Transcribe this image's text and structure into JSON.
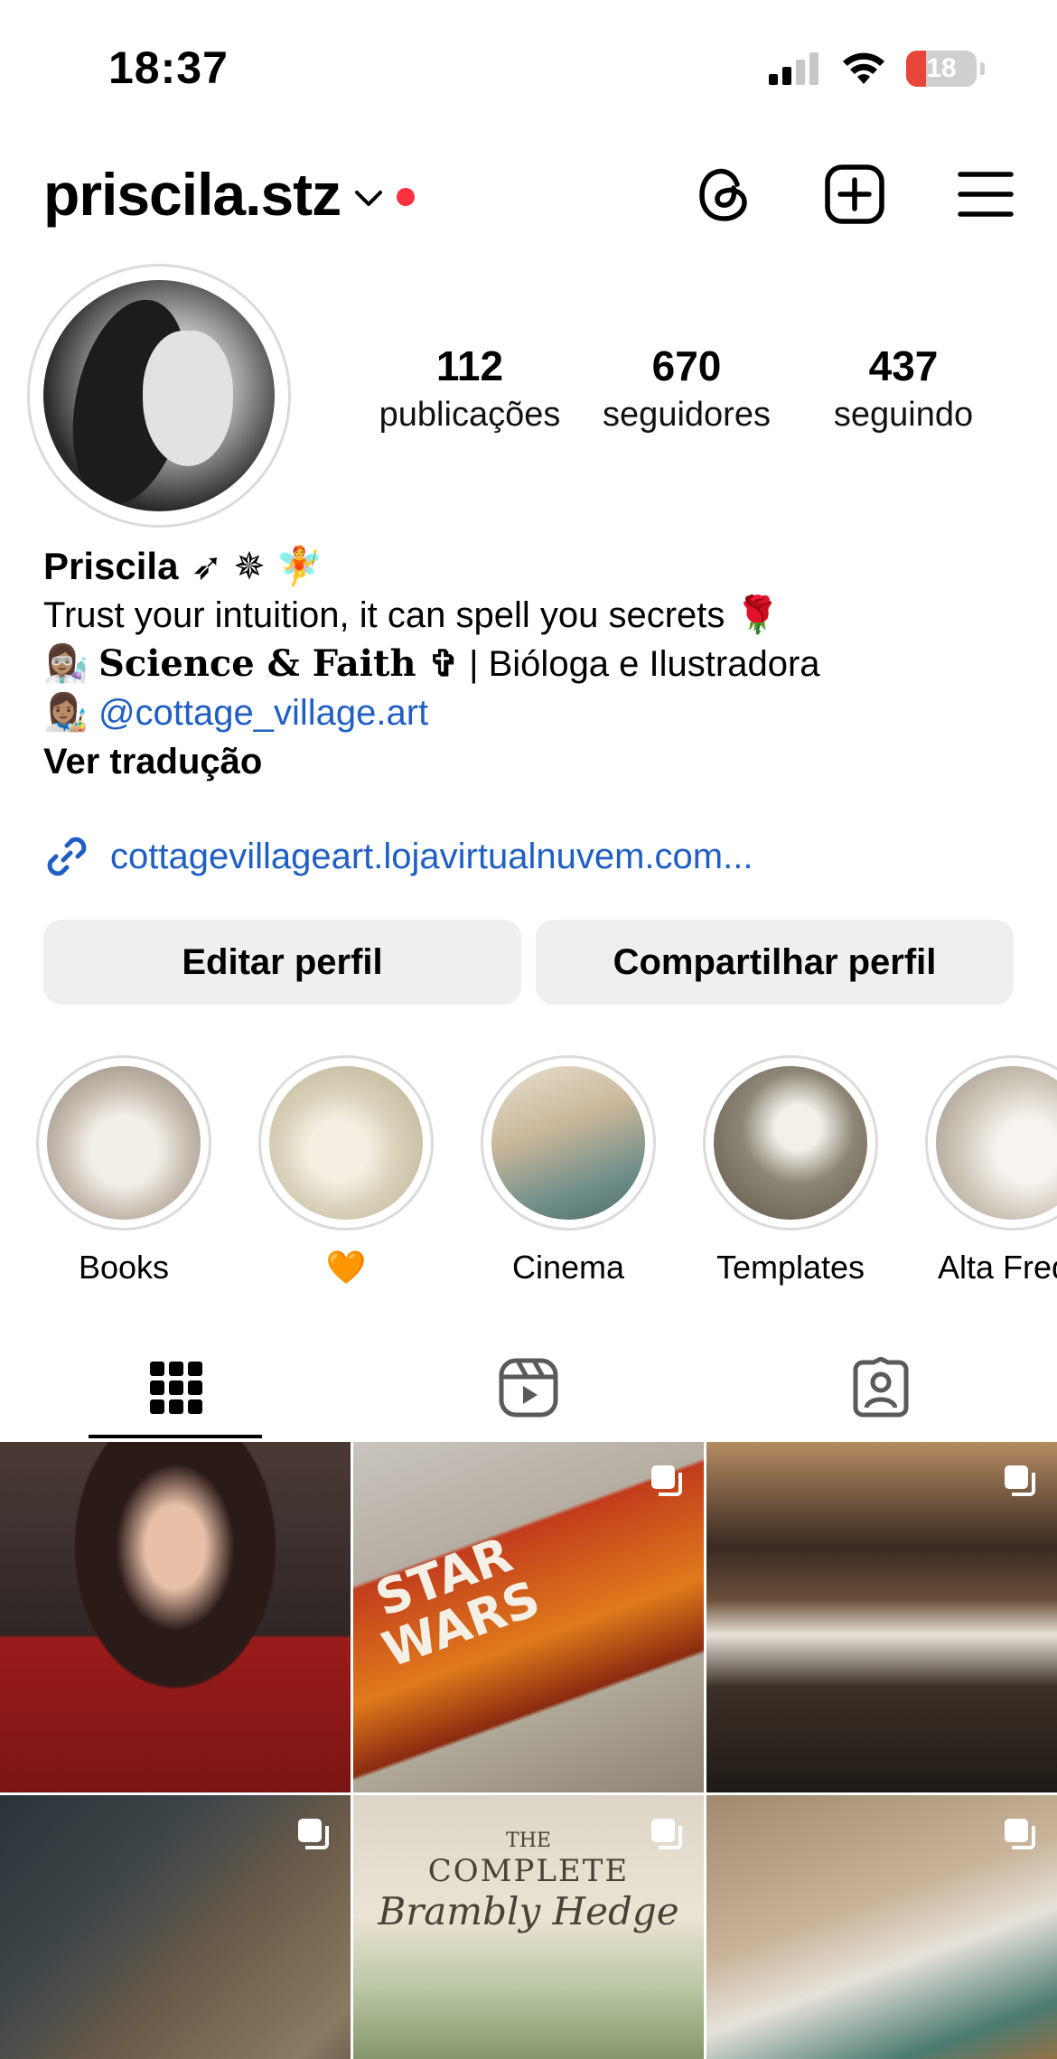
{
  "status_bar": {
    "time": "18:37",
    "battery": "18"
  },
  "header": {
    "username": "priscila.stz"
  },
  "profile": {
    "stats": [
      {
        "value": "112",
        "label": "publicações"
      },
      {
        "value": "670",
        "label": "seguidores"
      },
      {
        "value": "437",
        "label": "seguindo"
      }
    ],
    "name": "Priscila",
    "name_emojis": "➶  ✵  🧚",
    "bio_line1": "Trust your intuition, it can spell you secrets 🌹",
    "bio_line2_emoji": "👩🏽‍🔬",
    "bio_line2_serif": "Science & Faith ✞",
    "bio_line2_rest": " | Bióloga e Ilustradora",
    "bio_line3_emoji": "👩🏽‍🎨",
    "bio_line3_link": "@cottage_village.art",
    "see_translation": "Ver tradução",
    "external_link": "cottagevillageart.lojavirtualnuvem.com..."
  },
  "buttons": {
    "edit": "Editar perfil",
    "share": "Compartilhar perfil"
  },
  "highlights": [
    {
      "label": "Books"
    },
    {
      "label": "🧡"
    },
    {
      "label": "Cinema"
    },
    {
      "label": "Templates"
    },
    {
      "label": "Alta Frequ"
    }
  ],
  "grid_text": {
    "star_wars": "STAR WARS",
    "brambly_the": "THE",
    "brambly_complete": "COMPLETE",
    "brambly_title": "Brambly Hedge"
  },
  "colors": {
    "link": "#1f5fc4",
    "notification": "#ff3040",
    "button_bg": "#efefef"
  }
}
